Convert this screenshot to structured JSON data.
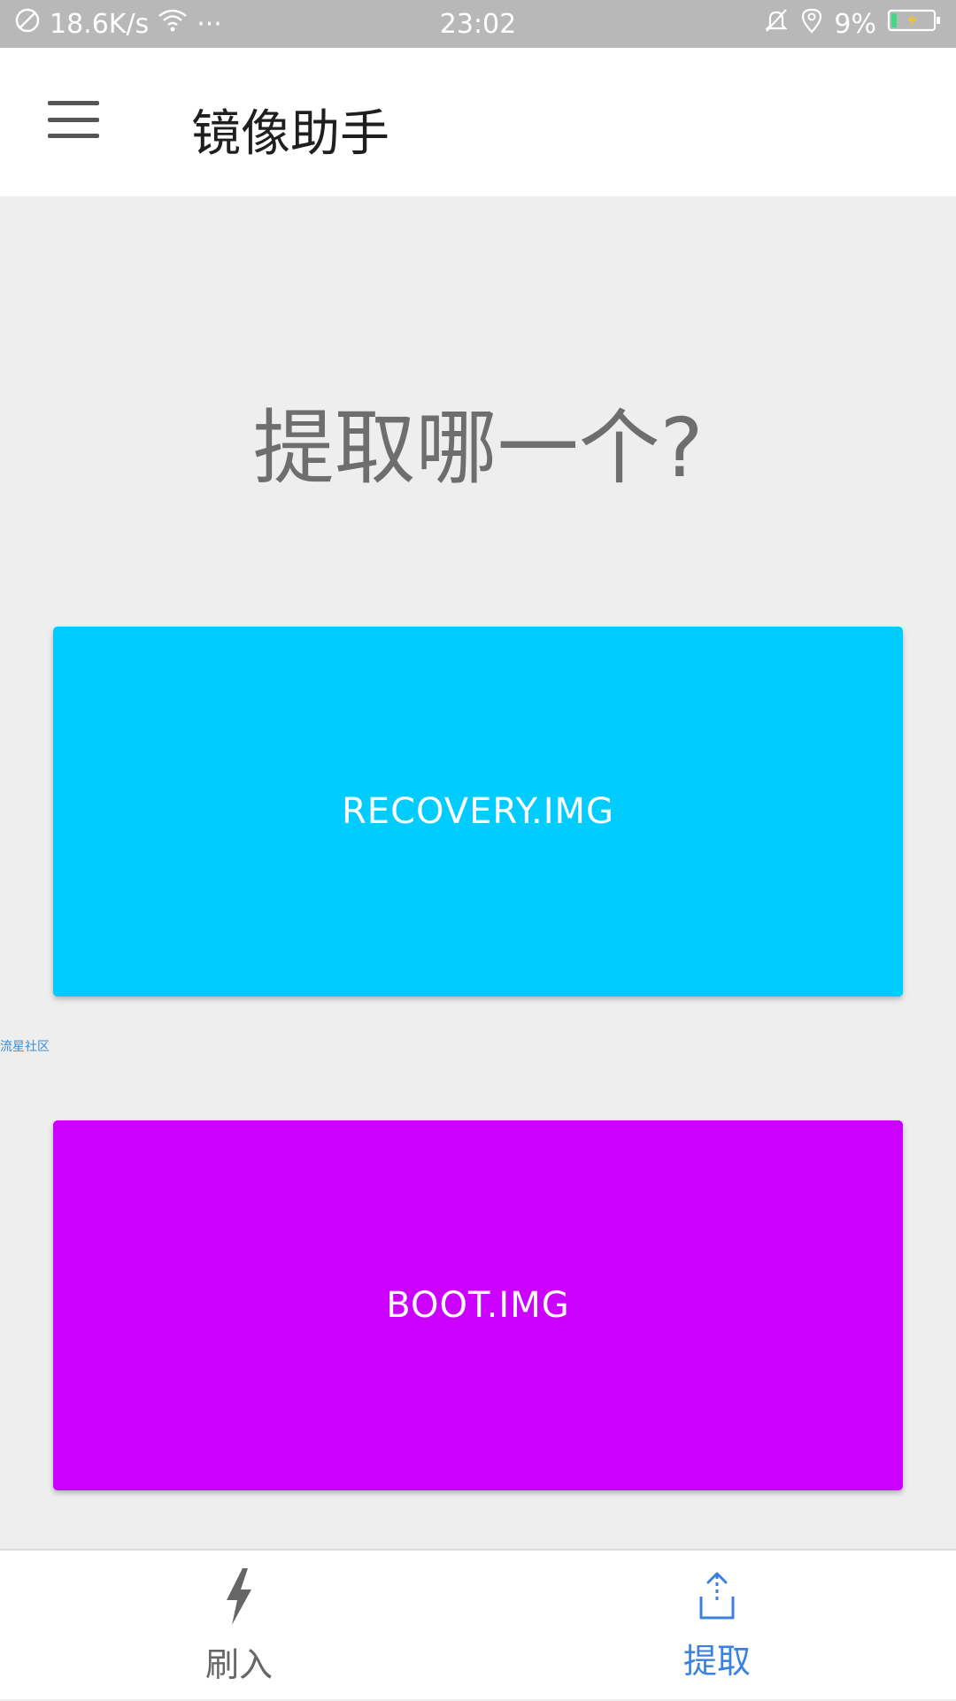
{
  "status_bar": {
    "speed": "18.6K/s",
    "more": "···",
    "time": "23:02",
    "battery": "9%"
  },
  "app_bar": {
    "title": "镜像助手"
  },
  "content": {
    "question": "提取哪一个?",
    "cards": [
      {
        "label": "RECOVERY.IMG",
        "color": "#00ccff"
      },
      {
        "label": "BOOT.IMG",
        "color": "#cc00ff"
      }
    ],
    "watermark": "流星社区"
  },
  "bottom_nav": {
    "items": [
      {
        "label": "刷入",
        "icon": "flash-icon"
      },
      {
        "label": "提取",
        "icon": "upload-icon"
      }
    ],
    "active_color": "#3b82e0",
    "inactive_color": "#666666"
  }
}
